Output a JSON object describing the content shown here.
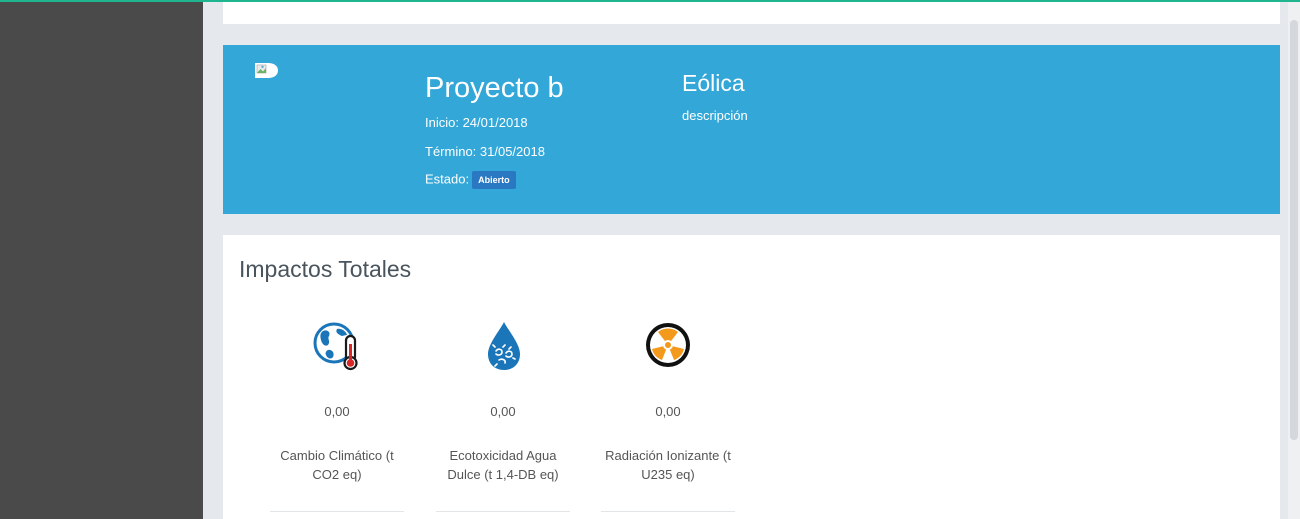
{
  "project": {
    "name": "Proyecto b",
    "start_label": "Inicio: 24/01/2018",
    "end_label": "Término: 31/05/2018",
    "status_label": "Estado:",
    "status_value": "Abierto",
    "category": "Eólica",
    "description": "descripción"
  },
  "impacts": {
    "title": "Impactos Totales",
    "items": [
      {
        "icon": "globe-thermometer-icon",
        "value": "0,00",
        "label": "Cambio Climático (t CO2 eq)"
      },
      {
        "icon": "water-drop-bacteria-icon",
        "value": "0,00",
        "label": "Ecotoxicidad Agua Dulce (t 1,4-DB eq)"
      },
      {
        "icon": "radiation-icon",
        "value": "0,00",
        "label": "Radiación Ionizante (t U235 eq)"
      }
    ]
  },
  "colors": {
    "accent_top": "#1fb58f",
    "sidebar": "#4a4a4a",
    "project_banner": "#33a7d8",
    "status_badge": "#2a78c2",
    "icon_blue": "#1a76b8",
    "radiation_orange": "#f39a1c"
  }
}
